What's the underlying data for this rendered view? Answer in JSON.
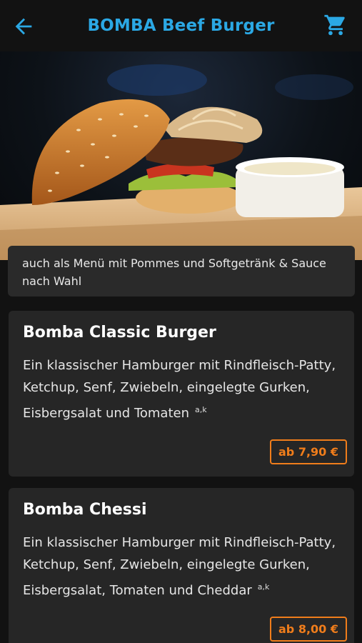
{
  "header": {
    "title": "BOMBA Beef Burger",
    "accent_color": "#2ba8e4",
    "back_icon": "arrow-left-icon",
    "cart_icon": "shopping-cart-icon"
  },
  "hero": {
    "image": "burger-photo"
  },
  "info": {
    "text": "auch als Menü mit Pommes und Softgetränk & Sauce nach Wahl"
  },
  "items": [
    {
      "name": "Bomba Classic Burger",
      "description": "Ein klassischer Hamburger mit Rindfleisch-Patty, Ketchup, Senf, Zwiebeln, eingelegte Gurken, Eisbergsalat und Tomaten",
      "allergens": "a,k",
      "price": "ab 7,90 €"
    },
    {
      "name": "Bomba Chessi",
      "description": "Ein klassischer Hamburger mit Rindfleisch-Patty, Ketchup, Senf, Zwiebeln, eingelegte Gurken, Eisbergsalat, Tomaten und Cheddar",
      "allergens": "a,k",
      "price": "ab 8,00 €"
    }
  ],
  "price_color": "#f07d1b"
}
